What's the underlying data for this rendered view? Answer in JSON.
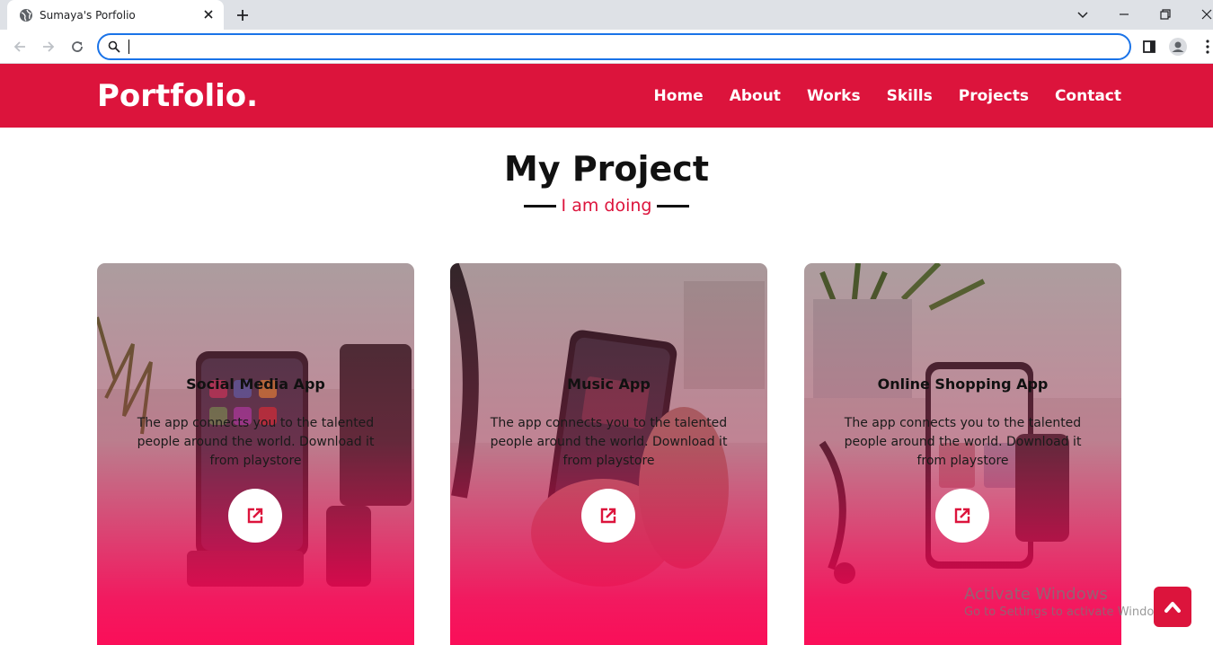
{
  "browser": {
    "tab_title": "Sumaya's Porfolio",
    "url_value": "",
    "url_placeholder": ""
  },
  "site": {
    "logo": "Portfolio.",
    "nav": [
      "Home",
      "About",
      "Works",
      "Skills",
      "Projects",
      "Contact"
    ]
  },
  "section": {
    "title": "My Project",
    "subtitle": "I am doing"
  },
  "projects": [
    {
      "title": "Social Media App",
      "description": "The app connects you to the talented people around the world. Download it from playstore",
      "link_icon": "external-link-icon"
    },
    {
      "title": "Music App",
      "description": "The app connects you to the talented people around the world. Download it from playstore",
      "link_icon": "external-link-icon"
    },
    {
      "title": "Online Shopping App",
      "description": "The app connects you to the talented people around the world. Download it from playstore",
      "link_icon": "external-link-icon"
    }
  ],
  "watermark": {
    "line1": "Activate Windows",
    "line2": "Go to Settings to activate Windows."
  },
  "scroll_top_icon": "chevron-up-icon",
  "colors": {
    "accent": "#dc143c",
    "header_bg": "#dc143c",
    "card_gradient_end": "#ff0050",
    "omnibox_focus": "#1a73e8"
  }
}
